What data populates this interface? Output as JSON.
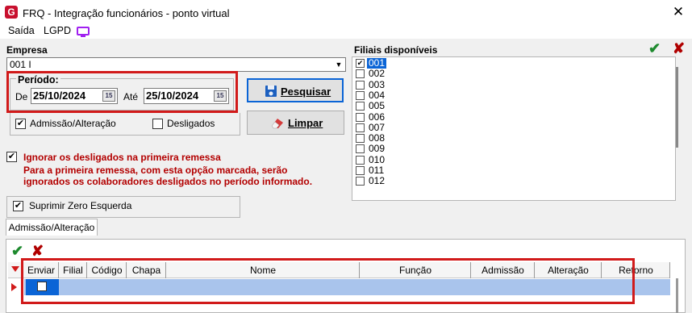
{
  "window": {
    "title": "FRQ - Integração funcionários - ponto virtual",
    "logo": "G",
    "close": "✕"
  },
  "menu": {
    "items": [
      "Saída",
      "LGPD"
    ],
    "icon": "screen-icon"
  },
  "empresa": {
    "label": "Empresa",
    "value": "001 I"
  },
  "periodo": {
    "label": "Período:",
    "de_label": "De",
    "de_value": "25/10/2024",
    "ate_label": "Até",
    "ate_value": "25/10/2024",
    "cal_icon": "15"
  },
  "buttons": {
    "pesquisar": "Pesquisar",
    "limpar": "Limpar"
  },
  "options": {
    "admissao": "Admissão/Alteração",
    "admissao_checked": true,
    "desligados": "Desligados",
    "desligados_checked": false,
    "ignorar": "Ignorar os desligados na primeira remessa",
    "ignorar_checked": true,
    "note_line1": "Para a primeira remessa, com esta opção marcada, serão",
    "note_line2": "ignorados os colaboradores desligados no período informado.",
    "suprimir": "Suprimir Zero Esquerda",
    "suprimir_checked": true
  },
  "filiais": {
    "label": "Filiais disponíveis",
    "confirm_icon": "✔",
    "delete_icon": "✘",
    "items": [
      {
        "code": "001",
        "checked": true,
        "selected": true
      },
      {
        "code": "002",
        "checked": false,
        "selected": false
      },
      {
        "code": "003",
        "checked": false,
        "selected": false
      },
      {
        "code": "004",
        "checked": false,
        "selected": false
      },
      {
        "code": "005",
        "checked": false,
        "selected": false
      },
      {
        "code": "006",
        "checked": false,
        "selected": false
      },
      {
        "code": "007",
        "checked": false,
        "selected": false
      },
      {
        "code": "008",
        "checked": false,
        "selected": false
      },
      {
        "code": "009",
        "checked": false,
        "selected": false
      },
      {
        "code": "010",
        "checked": false,
        "selected": false
      },
      {
        "code": "011",
        "checked": false,
        "selected": false
      },
      {
        "code": "012",
        "checked": false,
        "selected": false
      }
    ]
  },
  "tab": {
    "label": "Admissão/Alteração"
  },
  "grid": {
    "confirm_icon": "✔",
    "delete_icon": "✘",
    "columns": [
      "Enviar",
      "Filial",
      "Código",
      "Chapa",
      "Nome",
      "Função",
      "Admissão",
      "Alteração",
      "Retorno"
    ],
    "row": {
      "enviar_checked": false
    }
  },
  "colors": {
    "highlight": "#d11a1a",
    "selection": "#0a64d6",
    "row": "#a9c4ec",
    "note": "#b30000"
  }
}
